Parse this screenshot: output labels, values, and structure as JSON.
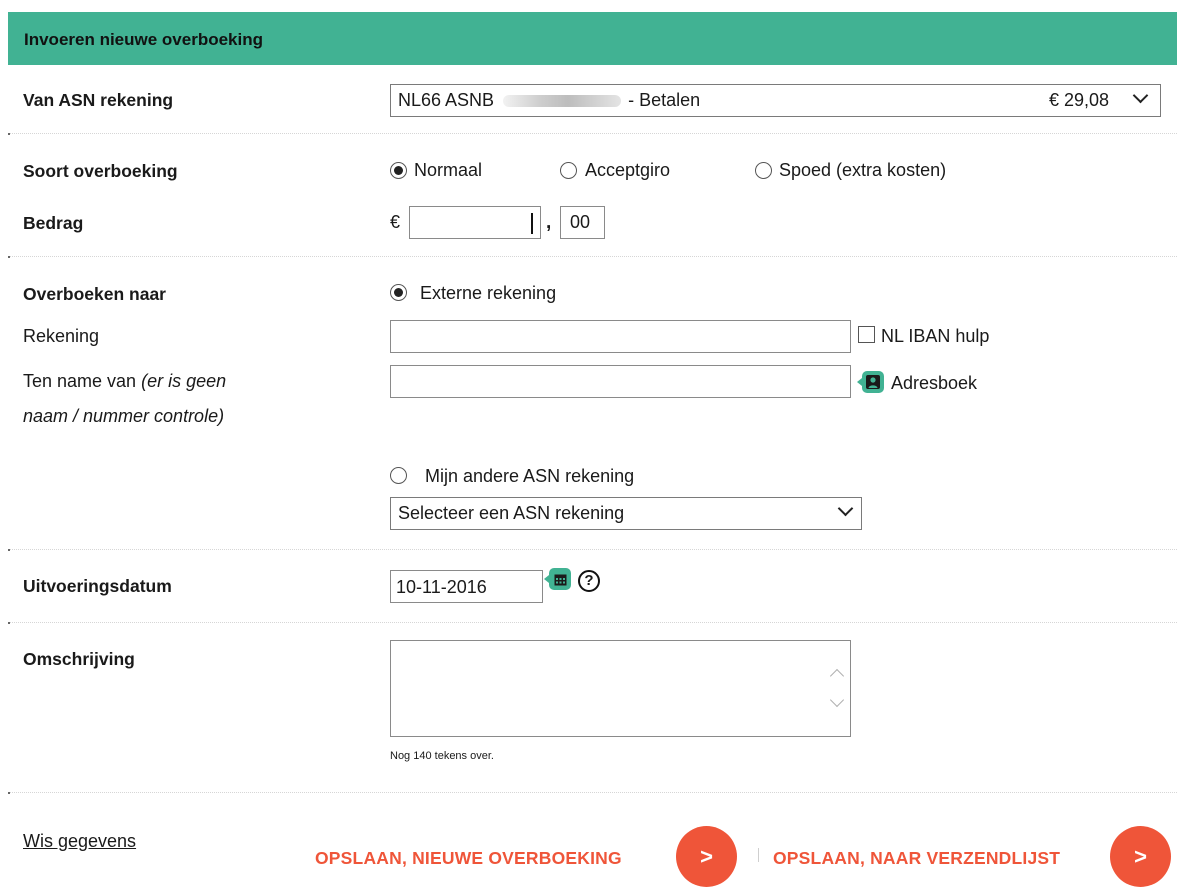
{
  "header": {
    "title": "Invoeren nieuwe overboeking"
  },
  "from_account": {
    "label": "Van ASN rekening",
    "prefix": "NL66 ASNB",
    "suffix": "- Betalen",
    "balance": "€ 29,08"
  },
  "transfer_type": {
    "label": "Soort overboeking",
    "options": [
      {
        "label": "Normaal",
        "selected": true
      },
      {
        "label": "Acceptgiro",
        "selected": false
      },
      {
        "label": "Spoed (extra kosten)",
        "selected": false
      }
    ]
  },
  "amount": {
    "label": "Bedrag",
    "currency": "€",
    "whole_value": "",
    "separator": ",",
    "cents_value": "00"
  },
  "transfer_to": {
    "label": "Overboeken naar",
    "external_option": "Externe rekening",
    "account_label": "Rekening",
    "account_value": "",
    "iban_help": "NL IBAN hulp",
    "name_label": "Ten name van",
    "name_note_line1": "(er is geen",
    "name_note_line2": "naam / nummer controle)",
    "name_value": "",
    "addressbook": "Adresboek",
    "own_option": "Mijn andere ASN rekening",
    "own_select": "Selecteer een ASN rekening"
  },
  "execution_date": {
    "label": "Uitvoeringsdatum",
    "value": "10-11-2016"
  },
  "description": {
    "label": "Omschrijving",
    "value": "",
    "remaining": "Nog 140 tekens over."
  },
  "actions": {
    "clear": "Wis gegevens",
    "save_new": "OPSLAAN, NIEUWE OVERBOEKING",
    "save_list": "OPSLAAN, NAAR VERZENDLIJST",
    "arrow": ">"
  },
  "colors": {
    "accent": "#41b293",
    "action": "#ef5539"
  }
}
